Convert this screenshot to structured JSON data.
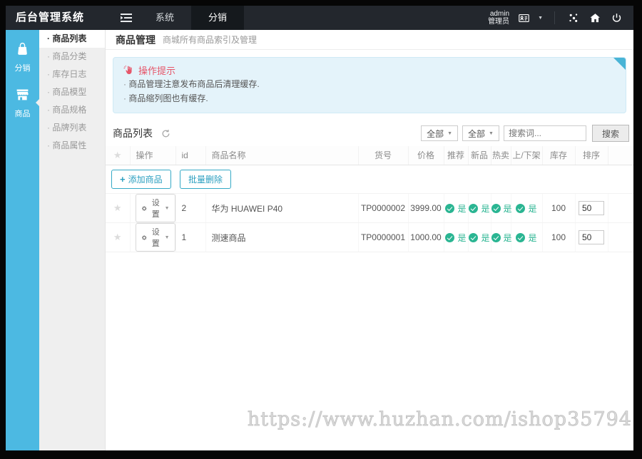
{
  "navbar": {
    "brand": "后台管理系统",
    "menu": [
      {
        "label": "系统"
      },
      {
        "label": "分销"
      }
    ],
    "user": {
      "name": "admin",
      "role": "管理员"
    }
  },
  "sidebar": {
    "modules": [
      {
        "label": "分销"
      },
      {
        "label": "商品"
      }
    ],
    "submenu": [
      "商品列表",
      "商品分类",
      "库存日志",
      "商品模型",
      "商品规格",
      "品牌列表",
      "商品属性"
    ]
  },
  "breadcrumb": {
    "title": "商品管理",
    "subtitle": "商城所有商品索引及管理"
  },
  "alert": {
    "title": "操作提示",
    "lines": [
      "商品管理注意发布商品后清理缓存.",
      "商品缩列图也有缓存."
    ]
  },
  "panel": {
    "title": "商品列表",
    "filters": {
      "category": "全部",
      "status": "全部",
      "search_placeholder": "搜索词...",
      "search_button": "搜索"
    },
    "toolbar": {
      "add": "添加商品",
      "batch_delete": "批量删除"
    },
    "table": {
      "headers": {
        "op": "操作",
        "id": "id",
        "name": "商品名称",
        "sku": "货号",
        "price": "价格",
        "recommend": "推荐",
        "is_new": "新品",
        "hot": "热卖",
        "on_sale": "上/下架",
        "stock": "库存",
        "sort": "排序"
      },
      "op_button": "设置",
      "rows": [
        {
          "id": "2",
          "name": "华为 HUAWEI P40",
          "sku": "TP0000002",
          "price": "3999.00",
          "recommend": "是",
          "is_new": "是",
          "hot": "是",
          "on_sale": "是",
          "stock": "100",
          "sort": "50"
        },
        {
          "id": "1",
          "name": "测速商品",
          "sku": "TP0000001",
          "price": "1000.00",
          "recommend": "是",
          "is_new": "是",
          "hot": "是",
          "on_sale": "是",
          "stock": "100",
          "sort": "50"
        }
      ]
    }
  },
  "watermark": "https://www.huzhan.com/ishop35794",
  "icons": {
    "star": "★",
    "caret": "▼"
  },
  "colors": {
    "accent_blue": "#4cb9e2",
    "navbar_bg": "#23272d",
    "navbar_active": "#15191d",
    "green": "#2ab592",
    "teal_button": "#2b9fc0",
    "alert_pink": "#e6566a",
    "alert_bg": "#e4f3fa",
    "alert_fold": "#49b4d6",
    "submenu_bg": "#efefef"
  }
}
